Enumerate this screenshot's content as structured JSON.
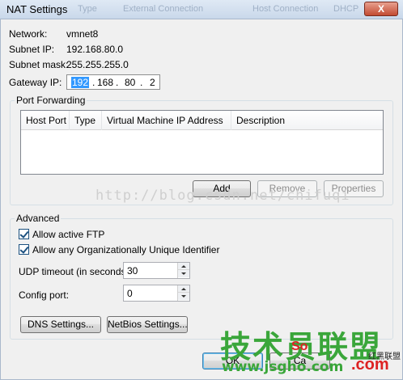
{
  "window": {
    "title": "NAT Settings",
    "close_label": "X"
  },
  "background_tabs": [
    "Type",
    "External Connection",
    "Host Connection",
    "DHCP"
  ],
  "info": {
    "network_label": "Network:",
    "network_value": "vmnet8",
    "subnet_ip_label": "Subnet IP:",
    "subnet_ip_value": "192.168.80.0",
    "subnet_mask_label": "Subnet mask:",
    "subnet_mask_value": "255.255.255.0",
    "gateway_label": "Gateway IP:",
    "gateway_octets": [
      "192",
      "168",
      "80",
      "2"
    ]
  },
  "port_forwarding": {
    "title": "Port Forwarding",
    "columns": [
      "Host Port",
      "Type",
      "Virtual Machine IP Address",
      "Description"
    ],
    "rows": [],
    "add_label": "Add",
    "remove_label": "Remove",
    "properties_label": "Properties"
  },
  "advanced": {
    "title": "Advanced",
    "allow_ftp_label": "Allow active FTP",
    "allow_ftp_checked": true,
    "allow_oui_label": "Allow any Organizationally Unique Identifier",
    "allow_oui_checked": true,
    "udp_timeout_label": "UDP timeout (in seconds):",
    "udp_timeout_value": "30",
    "config_port_label": "Config port:",
    "config_port_value": "0",
    "dns_settings_label": "DNS Settings...",
    "netbios_settings_label": "NetBios Settings..."
  },
  "dialog_buttons": {
    "ok_label": "OK",
    "cancel_label": "Ca"
  },
  "watermarks": {
    "url": "http://blog.csdn.net/chifuqi",
    "logo_text": "技术员联盟",
    "site": "www.jsgho.com",
    "com": ".com",
    "side": "红黑联盟",
    "red": "So"
  }
}
